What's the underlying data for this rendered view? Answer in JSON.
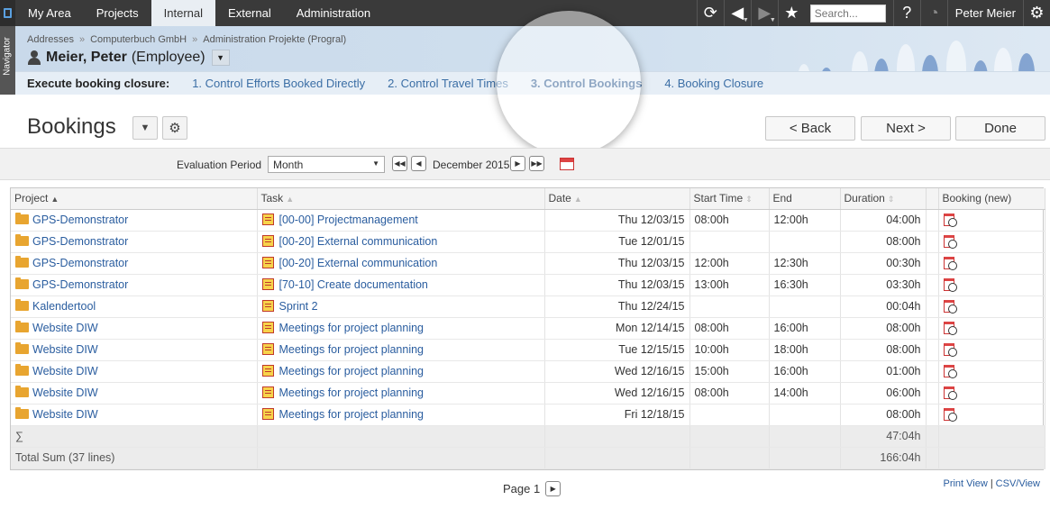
{
  "topnav": {
    "tabs": [
      "My Area",
      "Projects",
      "Internal",
      "External",
      "Administration"
    ],
    "active_tab": "Internal",
    "search_placeholder": "Search...",
    "user": "Peter Meier"
  },
  "navigator": {
    "label": "Navigator"
  },
  "breadcrumb": [
    "Addresses",
    "Computerbuch GmbH",
    "Administration Projekte (Progral)"
  ],
  "person": {
    "name": "Meier, Peter",
    "role": "(Employee)"
  },
  "steps": {
    "label": "Execute booking closure:",
    "items": [
      "1. Control Efforts Booked Directly",
      "2. Control Travel Times",
      "3. Control Bookings",
      "4. Booking Closure"
    ],
    "active": "3. Control Bookings"
  },
  "page": {
    "title": "Bookings"
  },
  "actions": {
    "back": "< Back",
    "next": "Next >",
    "done": "Done"
  },
  "filter": {
    "label": "Evaluation Period",
    "select_value": "Month",
    "period": "December 2015"
  },
  "table": {
    "columns": [
      "Project",
      "Task",
      "Date",
      "Start Time",
      "End",
      "Duration",
      "Booking (new)"
    ],
    "rows": [
      {
        "project": "GPS-Demonstrator",
        "task": "[00-00] Projectmanagement",
        "date": "Thu 12/03/15",
        "start": "08:00h",
        "end": "12:00h",
        "duration": "04:00h"
      },
      {
        "project": "GPS-Demonstrator",
        "task": "[00-20] External communication",
        "date": "Tue 12/01/15",
        "start": "",
        "end": "",
        "duration": "08:00h"
      },
      {
        "project": "GPS-Demonstrator",
        "task": "[00-20] External communication",
        "date": "Thu 12/03/15",
        "start": "12:00h",
        "end": "12:30h",
        "duration": "00:30h"
      },
      {
        "project": "GPS-Demonstrator",
        "task": "[70-10] Create documentation",
        "date": "Thu 12/03/15",
        "start": "13:00h",
        "end": "16:30h",
        "duration": "03:30h"
      },
      {
        "project": "Kalendertool",
        "task": "Sprint 2",
        "date": "Thu 12/24/15",
        "start": "",
        "end": "",
        "duration": "00:04h"
      },
      {
        "project": "Website DIW",
        "task": "Meetings for project planning",
        "date": "Mon 12/14/15",
        "start": "08:00h",
        "end": "16:00h",
        "duration": "08:00h"
      },
      {
        "project": "Website DIW",
        "task": "Meetings for project planning",
        "date": "Tue 12/15/15",
        "start": "10:00h",
        "end": "18:00h",
        "duration": "08:00h"
      },
      {
        "project": "Website DIW",
        "task": "Meetings for project planning",
        "date": "Wed 12/16/15",
        "start": "15:00h",
        "end": "16:00h",
        "duration": "01:00h"
      },
      {
        "project": "Website DIW",
        "task": "Meetings for project planning",
        "date": "Wed 12/16/15",
        "start": "08:00h",
        "end": "14:00h",
        "duration": "06:00h"
      },
      {
        "project": "Website DIW",
        "task": "Meetings for project planning",
        "date": "Fri 12/18/15",
        "start": "",
        "end": "",
        "duration": "08:00h"
      }
    ],
    "sum_symbol": "∑",
    "sum_value": "47:04h",
    "total_label": "Total Sum (37 lines)",
    "total_value": "166:04h"
  },
  "pager": {
    "label": "Page 1"
  },
  "links": {
    "print": "Print View",
    "csv": "CSV/View"
  },
  "colors": {
    "topbar": "#3a3a3a",
    "link": "#2a5d9f",
    "active_step": "#1f4f88"
  }
}
